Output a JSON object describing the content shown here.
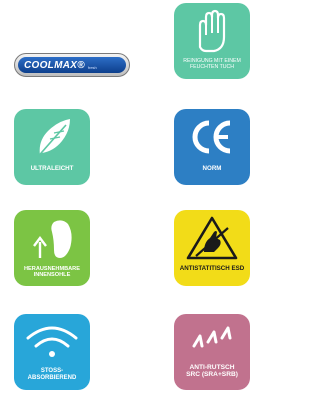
{
  "coolmax": {
    "brand": "COOLMAX®",
    "sub": "fresh"
  },
  "tiles": [
    {
      "label": "REINIGUNG MIT EINEM FEUCHTEN TUCH",
      "color": "#5dc7a4",
      "icon": "hand-icon"
    },
    {
      "label": "ULTRALEICHT",
      "color": "#5dc7a4",
      "icon": "feather-icon"
    },
    {
      "label": "NORM",
      "color": "#2d7fc4",
      "icon": "ce-mark-icon",
      "mark": "CE"
    },
    {
      "label": "HERAUSNEHMBARE INNENSOHLE",
      "color": "#7cc444",
      "icon": "insole-icon"
    },
    {
      "label": "ANTISTATITISCH ESD",
      "color": "#f2dc18",
      "icon": "esd-warning-icon"
    },
    {
      "label": "STOSS-ABSORBIEREND",
      "color": "#28a6d9",
      "icon": "shock-absorb-icon"
    },
    {
      "label": "ANTI-RUTSCH SRC (SRA+SRB)",
      "color": "#c1728e",
      "icon": "anti-slip-icon"
    }
  ]
}
